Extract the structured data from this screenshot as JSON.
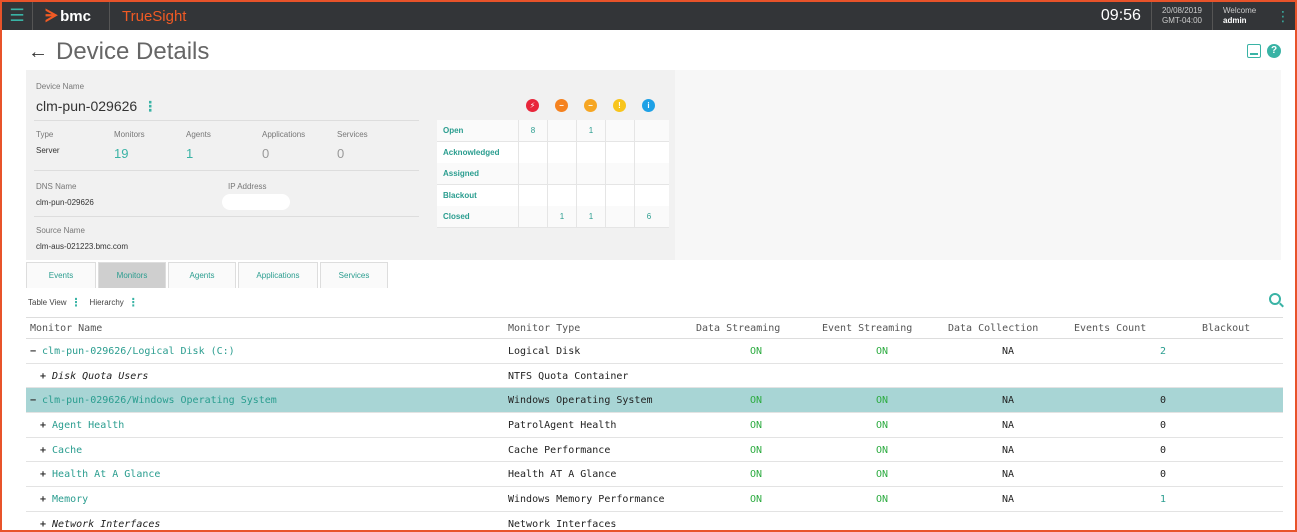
{
  "topbar": {
    "brand": "bmc",
    "product": "TrueSight",
    "time": "09:56",
    "date": "20/08/2019",
    "timezone": "GMT-04:00",
    "welcome": "Welcome",
    "user": "admin"
  },
  "page": {
    "title": "Device Details"
  },
  "summary": {
    "device_name_label": "Device Name",
    "device_name": "clm-pun-029626",
    "type_label": "Type",
    "type_value": "Server",
    "monitors_label": "Monitors",
    "monitors_value": "19",
    "agents_label": "Agents",
    "agents_value": "1",
    "applications_label": "Applications",
    "applications_value": "0",
    "services_label": "Services",
    "services_value": "0",
    "dns_label": "DNS Name",
    "dns_value": "clm-pun-029626",
    "ip_label": "IP Address",
    "source_label": "Source Name",
    "source_value": "clm-aus-021223.bmc.com"
  },
  "events_matrix": {
    "severities": [
      {
        "icon": "critical-icon",
        "color": "#e8263b",
        "glyph": "⚡"
      },
      {
        "icon": "major-icon",
        "color": "#f5821f",
        "glyph": "−"
      },
      {
        "icon": "minor-icon",
        "color": "#f6a623",
        "glyph": "−"
      },
      {
        "icon": "warning-icon",
        "color": "#f8c51c",
        "glyph": "!"
      },
      {
        "icon": "info-icon",
        "color": "#1ea1e6",
        "glyph": "i"
      }
    ],
    "rows": [
      {
        "label": "Open",
        "cells": [
          "8",
          "",
          "1",
          "",
          ""
        ]
      },
      {
        "label": "Acknowledged",
        "cells": [
          "",
          "",
          "",
          "",
          ""
        ]
      },
      {
        "label": "Assigned",
        "cells": [
          "",
          "",
          "",
          "",
          ""
        ]
      },
      {
        "label": "Blackout",
        "cells": [
          "",
          "",
          "",
          "",
          ""
        ]
      },
      {
        "label": "Closed",
        "cells": [
          "",
          "1",
          "1",
          "",
          "6"
        ]
      }
    ]
  },
  "tabs": [
    "Events",
    "Monitors",
    "Agents",
    "Applications",
    "Services"
  ],
  "active_tab": "Monitors",
  "view": {
    "table_view": "Table View",
    "hierarchy": "Hierarchy"
  },
  "table": {
    "columns": [
      "Monitor Name",
      "Monitor Type",
      "Data Streaming",
      "Event Streaming",
      "Data Collection",
      "Events Count",
      "Blackout"
    ],
    "rows": [
      {
        "expander": "−",
        "name": "clm-pun-029626/Logical Disk (C:)",
        "style": "link",
        "type": "Logical Disk",
        "data": "ON",
        "event": "ON",
        "collection": "NA",
        "count": "2",
        "count_style": "blue",
        "blackout": "",
        "selected": false
      },
      {
        "expander": "+",
        "name": "Disk Quota Users",
        "style": "italic",
        "type": "NTFS Quota Container",
        "data": "",
        "event": "",
        "collection": "",
        "count": "",
        "count_style": "",
        "blackout": "",
        "selected": false
      },
      {
        "expander": "−",
        "name": "clm-pun-029626/Windows Operating System",
        "style": "link",
        "type": "Windows Operating System",
        "data": "ON",
        "event": "ON",
        "collection": "NA",
        "count": "0",
        "count_style": "",
        "blackout": "",
        "selected": true
      },
      {
        "expander": "+",
        "name": "Agent Health",
        "style": "link",
        "type": "PatrolAgent Health",
        "data": "ON",
        "event": "ON",
        "collection": "NA",
        "count": "0",
        "count_style": "",
        "blackout": "",
        "selected": false
      },
      {
        "expander": "+",
        "name": "Cache",
        "style": "link",
        "type": "Cache Performance",
        "data": "ON",
        "event": "ON",
        "collection": "NA",
        "count": "0",
        "count_style": "",
        "blackout": "",
        "selected": false
      },
      {
        "expander": "+",
        "name": "Health At A Glance",
        "style": "link",
        "type": "Health AT A Glance",
        "data": "ON",
        "event": "ON",
        "collection": "NA",
        "count": "0",
        "count_style": "",
        "blackout": "",
        "selected": false
      },
      {
        "expander": "+",
        "name": "Memory",
        "style": "link",
        "type": "Windows Memory Performance",
        "data": "ON",
        "event": "ON",
        "collection": "NA",
        "count": "1",
        "count_style": "blue",
        "blackout": "",
        "selected": false
      },
      {
        "expander": "+",
        "name": "Network Interfaces",
        "style": "italic",
        "type": "Network Interfaces",
        "data": "",
        "event": "",
        "collection": "",
        "count": "",
        "count_style": "",
        "blackout": "",
        "selected": false
      }
    ]
  }
}
